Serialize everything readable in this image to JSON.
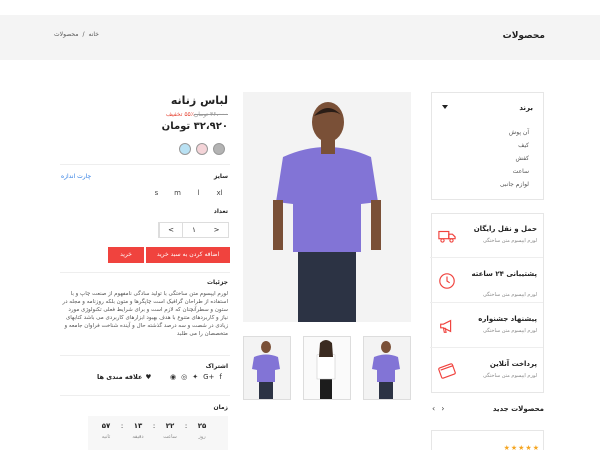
{
  "header": {
    "title": "محصولات",
    "breadcrumb": [
      "خانه",
      "/",
      "محصولات"
    ]
  },
  "sidebar": {
    "brand_title": "برند",
    "brands": [
      "آن پوش",
      "کیف",
      "کفش",
      "ساعت",
      "لوازم جانبی"
    ],
    "services": [
      {
        "title": "حمل و نقل رایگان",
        "subtitle": "لورم ایپسوم متن ساختگی",
        "icon": "truck-icon"
      },
      {
        "title": "پشتیبانی ۲۴ ساعته",
        "subtitle": "لورم ایپسوم متن ساختگی",
        "icon": "support-24-icon"
      },
      {
        "title": "پیشنهاد جشنواره",
        "subtitle": "لورم ایپسوم متن ساختگی",
        "icon": "megaphone-icon"
      },
      {
        "title": "پرداخت آنلاین",
        "subtitle": "لورم ایپسوم متن ساختگی",
        "icon": "credit-card-icon"
      }
    ],
    "new_products_title": "محصولات جدید",
    "stars": "★★★★★"
  },
  "product": {
    "title": "لباس زنانه",
    "old_price": "۳۶،۰۰۰ تومان",
    "discount": "۵۵٪ تخفیف",
    "price": "۳۲،۹۲۰ تومان",
    "colors": [
      "#b9e1f3",
      "#f4d4d8",
      "#b3b3b3"
    ],
    "size_label": "سایز",
    "size_chart": "چارت اندازه",
    "sizes": [
      "s",
      "m",
      "l",
      "xl"
    ],
    "qty_label": "تعداد",
    "qty_value": "۱",
    "qty_minus": "<",
    "qty_plus": ">",
    "add_to_cart": "اضافه کردن به سبد خرید",
    "buy": "خرید",
    "details_label": "جزئیات",
    "description": "لورم ایپسوم متن ساختگی با تولید سادگی نامفهوم از صنعت چاپ و با استفاده از طراحان گرافیک است چاپگرها و متون بلکه روزنامه و مجله در ستون و سطرآنچنان که لازم است و برای شرایط فعلی تکنولوژی مورد نیاز و کاربردهای متنوع با هدف بهبود ابزارهای کاربردی می باشد کتابهای زیادی در شصت و سه درصد گذشته حال و آینده شناخت فراوان جامعه و متخصصان را می طلبد",
    "share_label": "اشتراک",
    "favorite": "علاقه مندی ها",
    "time_label": "زمان",
    "timer": [
      {
        "value": "۲۵",
        "unit": "روز"
      },
      {
        "value": "۲۲",
        "unit": "ساعت"
      },
      {
        "value": "۱۳",
        "unit": "دقیقه"
      },
      {
        "value": "۵۷",
        "unit": "ثانیه"
      }
    ]
  }
}
